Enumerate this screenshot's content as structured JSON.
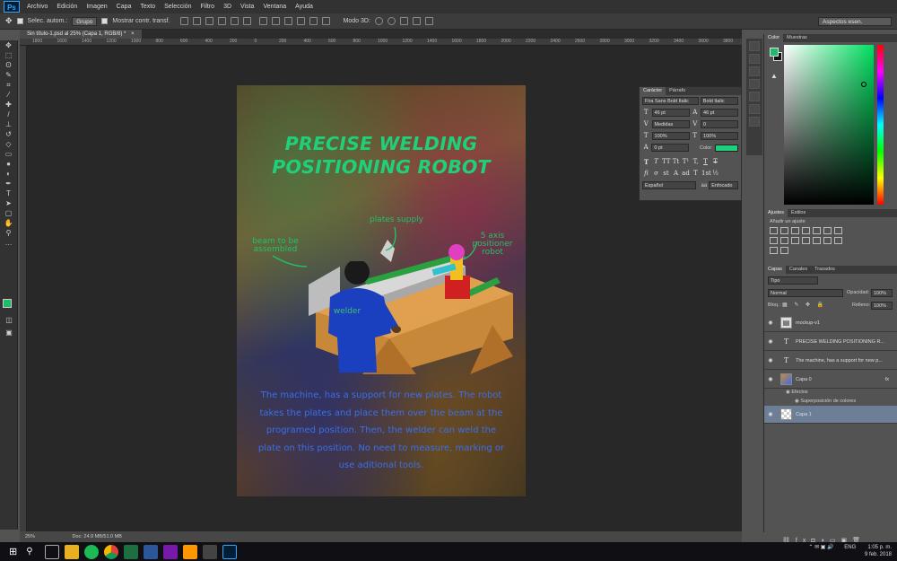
{
  "app": {
    "logo": "Ps",
    "menu": [
      "Archivo",
      "Edición",
      "Imagen",
      "Capa",
      "Texto",
      "Selección",
      "Filtro",
      "3D",
      "Vista",
      "Ventana",
      "Ayuda"
    ]
  },
  "options_bar": {
    "auto_select_label": "Selec. autom.:",
    "auto_select_value": "Grupo",
    "show_transform_label": "Mostrar contr. transf.",
    "mode_3d_label": "Modo 3D:",
    "workspace": "Aspectos esen."
  },
  "document": {
    "tab_title": "Sin título-1.psd al 25% (Capa 1, RGB/8) *",
    "ruler_ticks": [
      "1800",
      "1600",
      "1400",
      "1200",
      "1000",
      "800",
      "600",
      "400",
      "200",
      "0",
      "200",
      "400",
      "600",
      "800",
      "1000",
      "1200",
      "1400",
      "1600",
      "1800",
      "2000",
      "2200",
      "2400",
      "2600",
      "2800",
      "3000",
      "3200",
      "3400",
      "3600",
      "3800",
      "4000"
    ]
  },
  "poster": {
    "title_line1": "PRECISE WELDING",
    "title_line2": "POSITIONING ROBOT",
    "annotation_plates": "plates supply",
    "annotation_beam": "beam to be\nassembled",
    "annotation_positioner": "5 axis\npositioner\nrobot",
    "annotation_welder": "welder",
    "description_lines": [
      "The machine, has a support for new plates. The robot",
      "takes the plates and place them over the beam at the",
      "programed position. Then, the welder can weld the",
      "plate on this position. No need to measure, marking or",
      "use aditional tools."
    ]
  },
  "character_panel": {
    "tabs": [
      "Carácter",
      "Párrafo"
    ],
    "font_family": "Fira Sans Bold Italic",
    "font_style": "Bold Italic",
    "font_size": "46 pt",
    "leading": "46 pt",
    "kerning": "Medidas",
    "tracking": "0",
    "vertical_scale": "100%",
    "horizontal_scale": "100%",
    "baseline_shift": "0 pt",
    "color_label": "Color:",
    "color_value": "#1fd07a",
    "glyphs": [
      "T",
      "T",
      "TT",
      "Tt",
      "T¹",
      "T,",
      "T",
      "T"
    ],
    "glyphs2": [
      "fi",
      "σ",
      "st",
      "A",
      "ad",
      "T",
      "1st",
      "½"
    ],
    "language": "Español",
    "antialias_icon": "aa",
    "antialias": "Enfocado"
  },
  "color_panel": {
    "tabs": [
      "Color",
      "Muestras"
    ],
    "foreground": "#1fba6a",
    "background": "#111111"
  },
  "adjustments_panel": {
    "tabs": [
      "Ajustes",
      "Estilos"
    ],
    "add_label": "Añadir un ajuste"
  },
  "layers_panel": {
    "tabs": [
      "Capas",
      "Canales",
      "Trazados"
    ],
    "filter_kind": "Tipo",
    "blend_mode": "Normal",
    "opacity_label": "Opacidad:",
    "opacity": "100%",
    "lock_label": "Bloq.:",
    "fill_label": "Relleno:",
    "fill": "100%",
    "layers": [
      {
        "name": "mockup-v1",
        "type": "smart",
        "selected": false
      },
      {
        "name": "PRECISE WELDING  POSITIONING R...",
        "type": "text",
        "selected": false
      },
      {
        "name": "The machine, has a support for new p...",
        "type": "text",
        "selected": false
      },
      {
        "name": "Capa 0",
        "type": "image",
        "selected": false,
        "fx": "fx"
      },
      {
        "name": "Capa 1",
        "type": "empty",
        "selected": true
      }
    ],
    "effects_label": "Efectos",
    "effect_item": "Superposición de colores"
  },
  "status_bar": {
    "zoom": "25%",
    "doc_info": "Doc: 24.9 MB/51.0 MB"
  },
  "taskbar": {
    "time": "1:05 p. m.",
    "date": "9 feb. 2018",
    "language": "ENG"
  }
}
